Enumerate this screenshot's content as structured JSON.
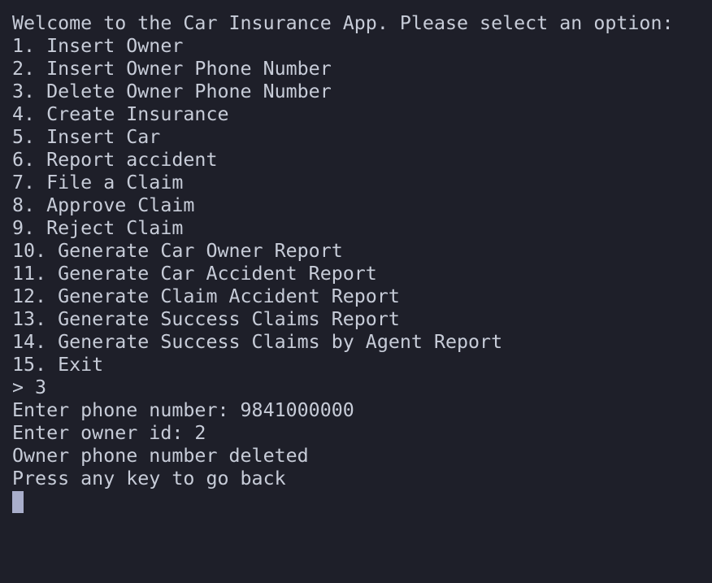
{
  "terminal": {
    "welcome": "Welcome to the Car Insurance App. Please select an option:",
    "menu": [
      "1. Insert Owner",
      "2. Insert Owner Phone Number",
      "3. Delete Owner Phone Number",
      "4. Create Insurance",
      "5. Insert Car",
      "6. Report accident",
      "7. File a Claim",
      "8. Approve Claim",
      "9. Reject Claim",
      "10. Generate Car Owner Report",
      "11. Generate Car Accident Report",
      "12. Generate Claim Accident Report",
      "13. Generate Success Claims Report",
      "14. Generate Success Claims by Agent Report",
      "15. Exit"
    ],
    "input_line": "> 3",
    "phone_prompt": "Enter phone number: 9841000000",
    "owner_prompt": "Enter owner id: 2",
    "result": "Owner phone number deleted",
    "back_prompt": "Press any key to go back"
  },
  "colors": {
    "background": "#1e1f29",
    "text": "#c7ccd8",
    "cursor": "#a9aecb"
  }
}
